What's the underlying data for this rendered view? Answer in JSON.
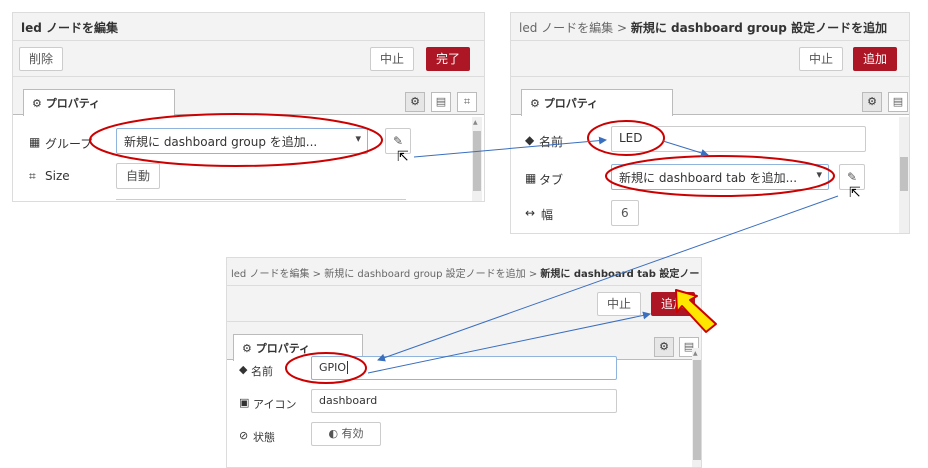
{
  "panel1": {
    "header_bold": "led ノードを編集",
    "delete_label": "削除",
    "cancel_label": "中止",
    "done_label": "完了",
    "tab_label": "⚙ プロパティ",
    "group_label": "グループ",
    "group_value": "新規に dashboard group を追加...",
    "size_label": "Size",
    "size_value": "自動"
  },
  "panel2": {
    "breadcrumb": "led ノードを編集 > ",
    "header_bold": "新規に dashboard group 設定ノードを追加",
    "cancel_label": "中止",
    "add_label": "追加",
    "tab_label": "⚙ プロパティ",
    "name_label": "名前",
    "name_value": "LED",
    "tab_field_label": "タブ",
    "tab_value": "新規に dashboard tab を追加...",
    "width_label": "幅",
    "width_value": "6"
  },
  "panel3": {
    "breadcrumb": "led ノードを編集 > 新規に dashboard group 設定ノードを追加 > ",
    "header_bold": "新規に dashboard tab 設定ノードを追加",
    "cancel_label": "中止",
    "add_label": "追加",
    "tab_label": "⚙ プロパティ",
    "name_label": "名前",
    "name_value": "GPIO",
    "icon_label": "アイコン",
    "icon_value": "dashboard",
    "state_label": "状態",
    "state_value": "有効"
  },
  "colors": {
    "accent_red": "#ad1625",
    "annotation_red": "#cc0000",
    "annotation_blue": "#3a6ebf",
    "arrow_yellow": "#ffe600"
  }
}
